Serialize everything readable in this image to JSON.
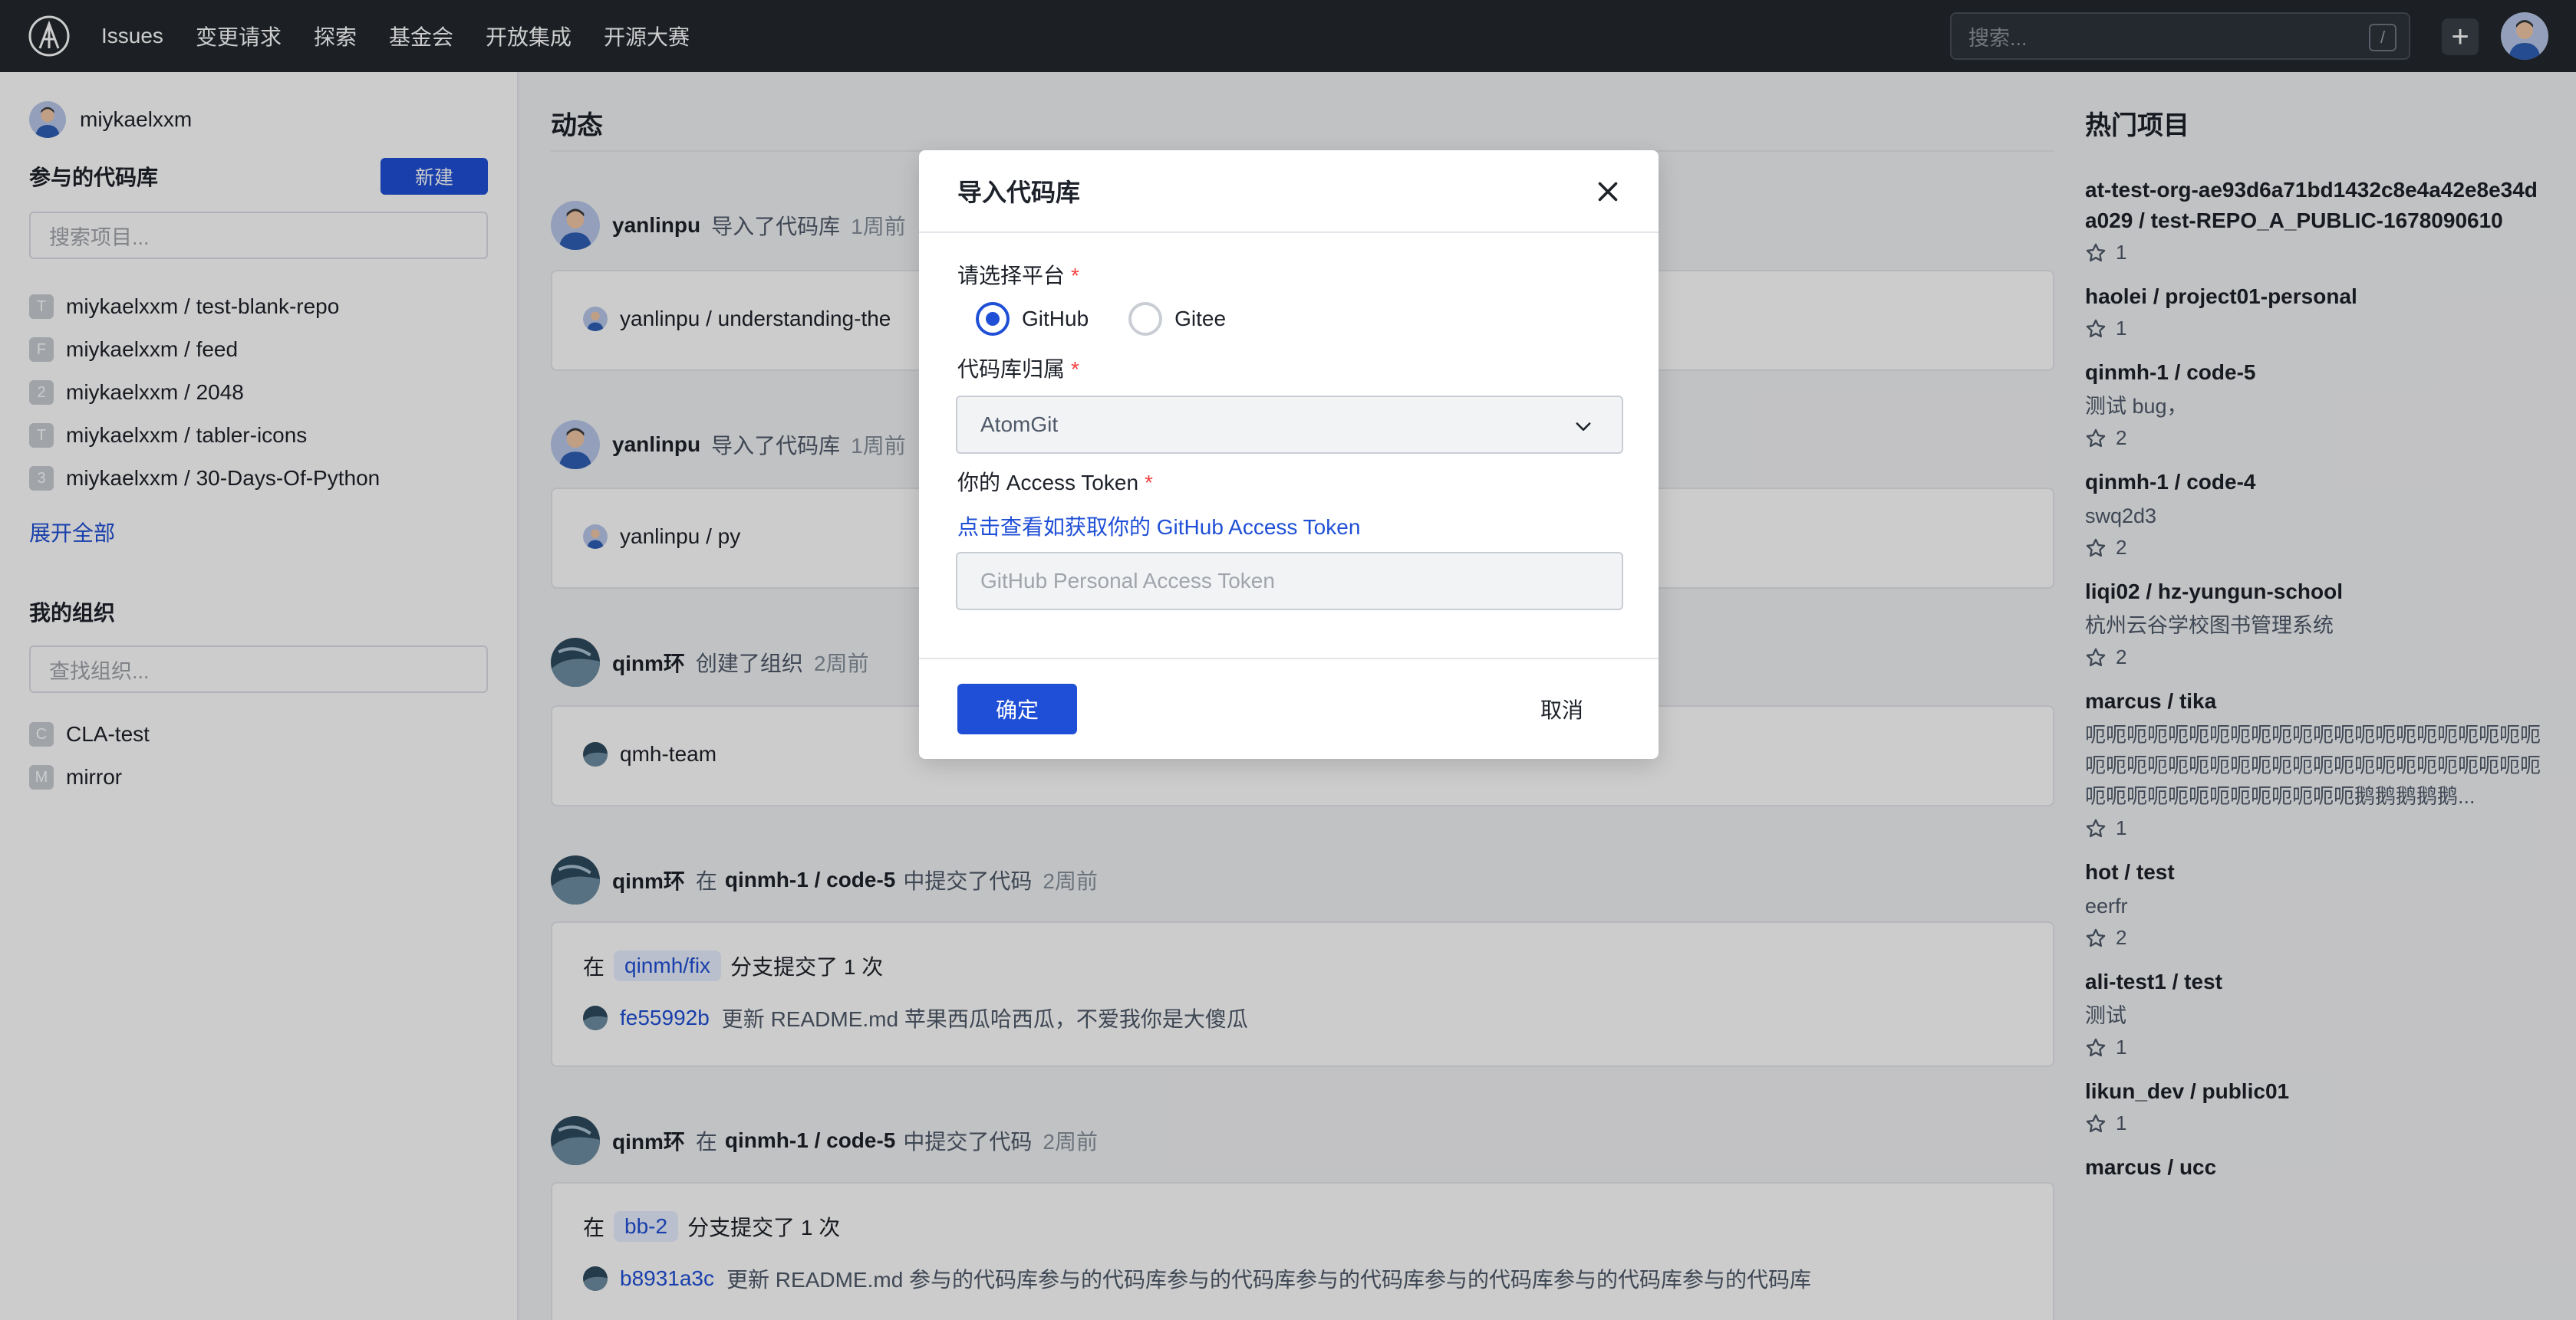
{
  "topbar": {
    "nav": [
      "Issues",
      "变更请求",
      "探索",
      "基金会",
      "开放集成",
      "开源大赛"
    ],
    "search_placeholder": "搜索...",
    "search_shortcut": "/",
    "plus_label": "+"
  },
  "sidebar": {
    "username": "miykaelxxm",
    "repos_heading": "参与的代码库",
    "new_button": "新建",
    "repo_search_placeholder": "搜索项目...",
    "repos": [
      {
        "badge": "T",
        "name": "miykaelxxm / test-blank-repo"
      },
      {
        "badge": "F",
        "name": "miykaelxxm / feed"
      },
      {
        "badge": "2",
        "name": "miykaelxxm / 2048"
      },
      {
        "badge": "T",
        "name": "miykaelxxm / tabler-icons"
      },
      {
        "badge": "3",
        "name": "miykaelxxm / 30-Days-Of-Python"
      }
    ],
    "expand_all": "展开全部",
    "orgs_heading": "我的组织",
    "org_search_placeholder": "查找组织...",
    "orgs": [
      {
        "badge": "C",
        "name": "CLA-test"
      },
      {
        "badge": "M",
        "name": "mirror"
      }
    ]
  },
  "feed": {
    "title": "动态",
    "events": [
      {
        "user": "yanlinpu",
        "action": "导入了代码库",
        "time": "1周前",
        "card_text": "yanlinpu / understanding-the"
      },
      {
        "user": "yanlinpu",
        "action": "导入了代码库",
        "time": "1周前",
        "card_text": "yanlinpu / py"
      },
      {
        "user": "qinm环",
        "action": "创建了组织",
        "time": "2周前",
        "card_text": "qmh-team"
      },
      {
        "user": "qinm环",
        "action_prefix": "在",
        "repo": "qinmh-1 / code-5",
        "action_suffix": "中提交了代码",
        "time": "2周前",
        "branch_prefix": "在",
        "branch": "qinmh/fix",
        "branch_suffix": "分支提交了 1 次",
        "sha": "fe55992b",
        "commit_msg": "更新 README.md 苹果西瓜哈西瓜，不爱我你是大傻瓜"
      },
      {
        "user": "qinm环",
        "action_prefix": "在",
        "repo": "qinmh-1 / code-5",
        "action_suffix": "中提交了代码",
        "time": "2周前",
        "branch_prefix": "在",
        "branch": "bb-2",
        "branch_suffix": "分支提交了 1 次",
        "sha": "b8931a3c",
        "commit_msg": "更新 README.md 参与的代码库参与的代码库参与的代码库参与的代码库参与的代码库参与的代码库参与的代码库"
      }
    ]
  },
  "hot": {
    "title": "热门项目",
    "items": [
      {
        "name": "at-test-org-ae93d6a71bd1432c8e4a42e8e34da029 / test-REPO_A_PUBLIC-1678090610",
        "desc": "",
        "stars": "1"
      },
      {
        "name": "haolei / project01-personal",
        "desc": "",
        "stars": "1"
      },
      {
        "name": "qinmh-1 / code-5",
        "desc": "测试 bug，",
        "stars": "2"
      },
      {
        "name": "qinmh-1 / code-4",
        "desc": "swq2d3",
        "stars": "2"
      },
      {
        "name": "liqi02 / hz-yungun-school",
        "desc": "杭州云谷学校图书管理系统",
        "stars": "2"
      },
      {
        "name": "marcus / tika",
        "desc": "呃呃呃呃呃呃呃呃呃呃呃呃呃呃呃呃呃呃呃呃呃呃呃呃呃呃呃呃呃呃呃呃呃呃呃呃呃呃呃呃呃呃呃呃呃呃呃呃呃呃呃呃呃呃呃呃呃鹅鹅鹅鹅鹅...",
        "stars": "1"
      },
      {
        "name": "hot / test",
        "desc": "eerfr",
        "stars": "2"
      },
      {
        "name": "ali-test1 / test",
        "desc": "测试",
        "stars": "1"
      },
      {
        "name": "likun_dev / public01",
        "desc": "",
        "stars": "1"
      },
      {
        "name": "marcus / ucc",
        "desc": "",
        "stars": ""
      }
    ]
  },
  "modal": {
    "title": "导入代码库",
    "platform_label": "请选择平台",
    "required_mark": "*",
    "platforms": [
      "GitHub",
      "Gitee"
    ],
    "selected_platform": "GitHub",
    "owner_label": "代码库归属",
    "owner_value": "AtomGit",
    "token_label": "你的 Access Token",
    "token_help_link": "点击查看如获取你的 GitHub Access Token",
    "token_placeholder": "GitHub Personal Access Token",
    "confirm": "确定",
    "cancel": "取消"
  },
  "colors": {
    "accent": "#1f4fd6",
    "topbar_bg": "#24292f",
    "required": "#f53f3f"
  }
}
